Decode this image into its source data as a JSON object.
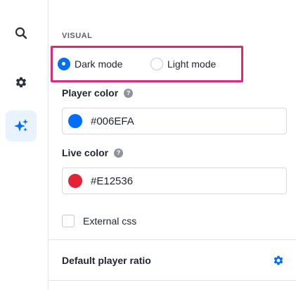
{
  "sidebar": {
    "items": [
      {
        "icon": "search-icon"
      },
      {
        "icon": "gear-icon"
      },
      {
        "icon": "sparkle-icon",
        "active": true
      }
    ]
  },
  "visual": {
    "section_label": "VISUAL",
    "mode_options": [
      "Dark mode",
      "Light mode"
    ],
    "selected_mode": "Dark mode",
    "player_color": {
      "label": "Player color",
      "help_glyph": "?",
      "value": "#006EFA"
    },
    "live_color": {
      "label": "Live color",
      "help_glyph": "?",
      "value": "#E12536"
    },
    "external_css": {
      "label": "External css",
      "checked": false
    }
  },
  "ratio": {
    "title": "Default player ratio",
    "icon": "gear-icon"
  },
  "colors": {
    "accent": "#006EFA",
    "highlight_border": "#E0287A",
    "active_bg": "#E9F2FF"
  }
}
